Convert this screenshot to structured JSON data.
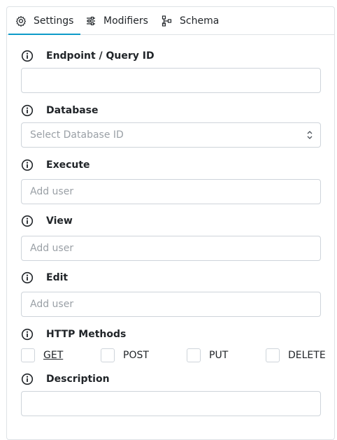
{
  "tabs": [
    {
      "label": "Settings",
      "icon": "gear-icon",
      "active": true
    },
    {
      "label": "Modifiers",
      "icon": "sliders-icon",
      "active": false
    },
    {
      "label": "Schema",
      "icon": "schema-tree-icon",
      "active": false
    }
  ],
  "fields": {
    "endpoint": {
      "label": "Endpoint / Query ID",
      "value": "",
      "placeholder": ""
    },
    "database": {
      "label": "Database",
      "placeholder": "Select Database ID"
    },
    "execute": {
      "label": "Execute",
      "placeholder": "Add user"
    },
    "view": {
      "label": "View",
      "placeholder": "Add user"
    },
    "edit": {
      "label": "Edit",
      "placeholder": "Add user"
    },
    "http_methods": {
      "label": "HTTP Methods",
      "options": [
        {
          "label": "GET",
          "checked": false
        },
        {
          "label": "POST",
          "checked": false
        },
        {
          "label": "PUT",
          "checked": false
        },
        {
          "label": "DELETE",
          "checked": false
        }
      ]
    },
    "description": {
      "label": "Description",
      "value": ""
    }
  },
  "colors": {
    "accent": "#0d9ac9",
    "border": "#ced4da",
    "placeholder": "#9aa0a6"
  }
}
